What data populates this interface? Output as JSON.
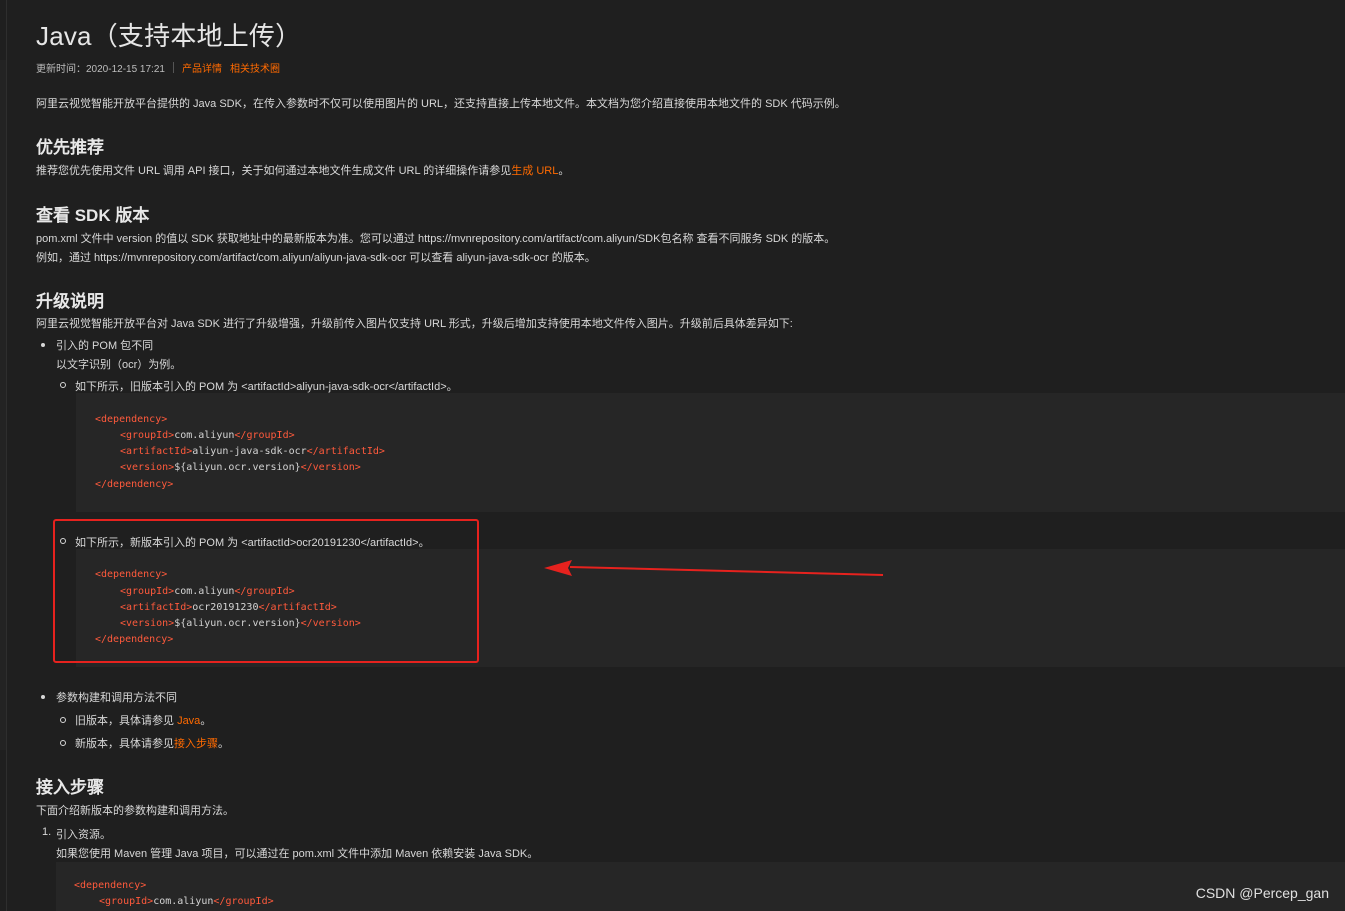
{
  "title": "Java（支持本地上传）",
  "meta": {
    "updated": "更新时间：2020-12-15 17:21",
    "link1": "产品详情",
    "link2": "相关技术圈"
  },
  "intro": "阿里云视觉智能开放平台提供的 Java SDK，在传入参数时不仅可以使用图片的 URL，还支持直接上传本地文件。本文档为您介绍直接使用本地文件的 SDK 代码示例。",
  "sec1": {
    "heading": "优先推荐",
    "text_before": "推荐您优先使用文件 URL 调用 API 接口，关于如何通过本地文件生成文件 URL 的详细操作请参见",
    "link": "生成 URL",
    "text_after": "。"
  },
  "sec2": {
    "heading": "查看 SDK 版本",
    "line1": "pom.xml 文件中 version 的值以 SDK 获取地址中的最新版本为准。您可以通过 https://mvnrepository.com/artifact/com.aliyun/SDK包名称 查看不同服务 SDK 的版本。",
    "line2": "例如，通过 https://mvnrepository.com/artifact/com.aliyun/aliyun-java-sdk-ocr 可以查看 aliyun-java-sdk-ocr 的版本。"
  },
  "sec3": {
    "heading": "升级说明",
    "intro": "阿里云视觉智能开放平台对 Java SDK 进行了升级增强，升级前传入图片仅支持 URL 形式，升级后增加支持使用本地文件传入图片。升级前后具体差异如下:",
    "b1": "引入的 POM 包不同",
    "b1_sub": "以文字识别（ocr）为例。",
    "b1_old": "如下所示，旧版本引入的 POM 为 <artifactId>aliyun-java-sdk-ocr</artifactId>。",
    "b1_new": "如下所示，新版本引入的 POM 为 <artifactId>ocr20191230</artifactId>。",
    "code_old": {
      "open": "<dependency>",
      "g_open": "<groupId>",
      "g_val": "com.aliyun",
      "g_close": "</groupId>",
      "a_open": "<artifactId>",
      "a_val": "aliyun-java-sdk-ocr",
      "a_close": "</artifactId>",
      "v_open": "<version>",
      "v_val": "${aliyun.ocr.version}",
      "v_close": "</version>",
      "close": "</dependency>"
    },
    "code_new": {
      "open": "<dependency>",
      "g_open": "<groupId>",
      "g_val": "com.aliyun",
      "g_close": "</groupId>",
      "a_open": "<artifactId>",
      "a_val": "ocr20191230",
      "a_close": "</artifactId>",
      "v_open": "<version>",
      "v_val": "${aliyun.ocr.version}",
      "v_close": "</version>",
      "close": "</dependency>"
    },
    "b2": "参数构建和调用方法不同",
    "b2_old_before": "旧版本，具体请参见 ",
    "b2_old_link": "Java",
    "b2_old_after": "。",
    "b2_new_before": "新版本，具体请参见",
    "b2_new_link": "接入步骤",
    "b2_new_after": "。"
  },
  "sec4": {
    "heading": "接入步骤",
    "intro": "下面介绍新版本的参数构建和调用方法。",
    "step1_num": "1.",
    "step1": "引入资源。",
    "step1_desc": "如果您使用 Maven 管理 Java 项目，可以通过在 pom.xml 文件中添加 Maven 依赖安装 Java SDK。",
    "code": {
      "open": "<dependency>",
      "g_open": "<groupId>",
      "g_val": "com.aliyun",
      "g_close": "</groupId>"
    }
  },
  "watermark": "CSDN @Percep_gan",
  "colors": {
    "accent": "#ff6a00",
    "tag": "#ff5a3c",
    "highlight": "#e6221e",
    "background": "#1f1f1f"
  }
}
